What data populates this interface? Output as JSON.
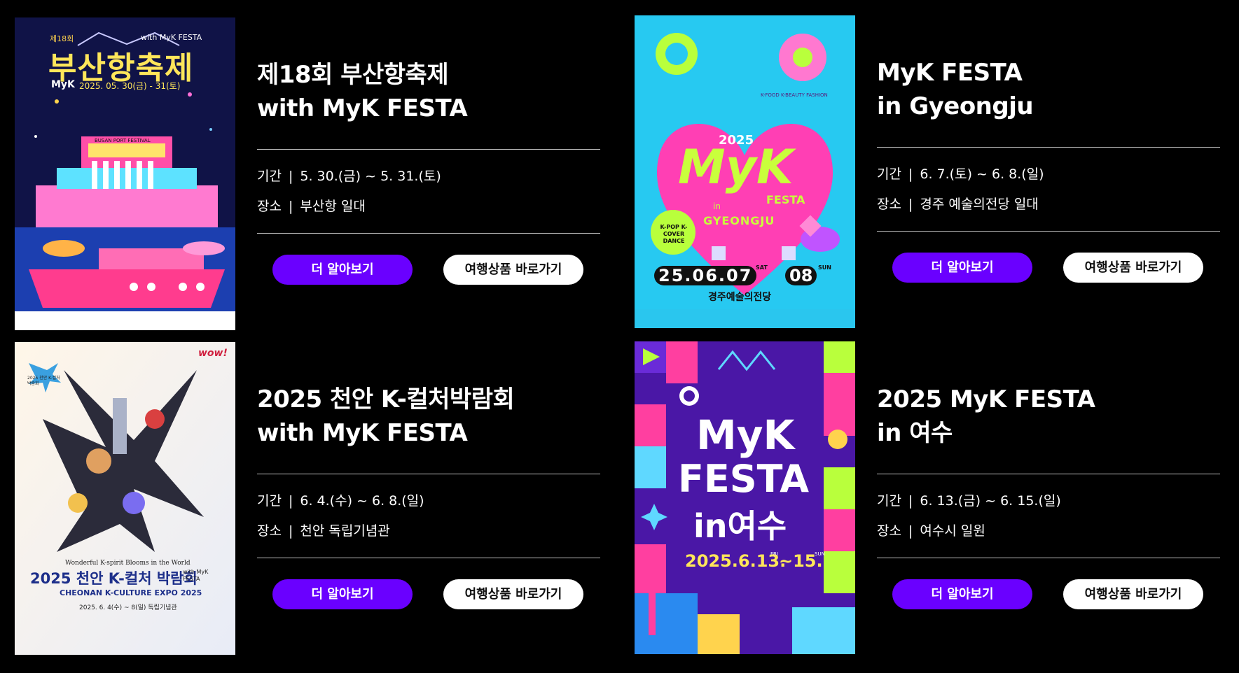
{
  "events": [
    {
      "title_line1": "제18회 부산항축제",
      "title_line2": "with MyK FESTA",
      "period_label": "기간",
      "period": "5. 30.(금) ~ 5. 31.(토)",
      "place_label": "장소",
      "place": "부산항 일대",
      "more_label": "더 알아보기",
      "travel_label": "여행상품 바로가기",
      "poster": {
        "top_left": "제18회",
        "top_right": "with MyK FESTA",
        "main_title": "부산항축제",
        "brand": "MyK",
        "date": "2025. 05. 30(금) - 31(토)",
        "small_note": "BUSAN PORT FESTIVAL"
      }
    },
    {
      "title_line1": "MyK FESTA",
      "title_line2": "in Gyeongju",
      "period_label": "기간",
      "period": "6. 7.(토) ~ 6. 8.(일)",
      "place_label": "장소",
      "place": "경주 예술의전당 일대",
      "more_label": "더 알아보기",
      "travel_label": "여행상품 바로가기",
      "poster": {
        "year": "2025",
        "logo": "MyK",
        "festa": "FESTA",
        "in": "in",
        "city": "GYEONGJU",
        "badge": "K-POP K-COVER DANCE",
        "arc_text": "K-FOOD K-BEAUTY FASHION",
        "date_left": "25.06.07",
        "sat": "SAT",
        "date_right": "08",
        "sun": "SUN",
        "venue": "경주예술의전당"
      }
    },
    {
      "title_line1": "2025 천안 K-컬처박람회",
      "title_line2": "with MyK FESTA",
      "period_label": "기간",
      "period": "6. 4.(수) ~ 6. 8.(일)",
      "place_label": "장소",
      "place": "천안 독립기념관",
      "more_label": "더 알아보기",
      "travel_label": "여행상품 바로가기",
      "poster": {
        "corner_tag": "2025 천안 K-컬처박람회",
        "wow": "wow!",
        "tagline": "Wonderful K-spirit Blooms in the World",
        "main_title": "2025 천안 K-컬처 박람회",
        "with": "with MyK FESTA",
        "english": "CHEONAN K-CULTURE EXPO 2025",
        "date": "2025. 6. 4(수) ~ 8(일) 독립기념관"
      }
    },
    {
      "title_line1": "2025 MyK FESTA",
      "title_line2": "in 여수",
      "period_label": "기간",
      "period": "6. 13.(금) ~ 6. 15.(일)",
      "place_label": "장소",
      "place": "여수시 일원",
      "more_label": "더 알아보기",
      "travel_label": "여행상품 바로가기",
      "poster": {
        "line1": "MyK",
        "line2": "FESTA",
        "line3": "in여수",
        "date": "2025.6.13.",
        "fri": "FRI",
        "end": "~15.",
        "sun": "SUN"
      }
    }
  ],
  "colors": {
    "accent": "#6a00ff",
    "background": "#000000",
    "button_light": "#ffffff"
  }
}
